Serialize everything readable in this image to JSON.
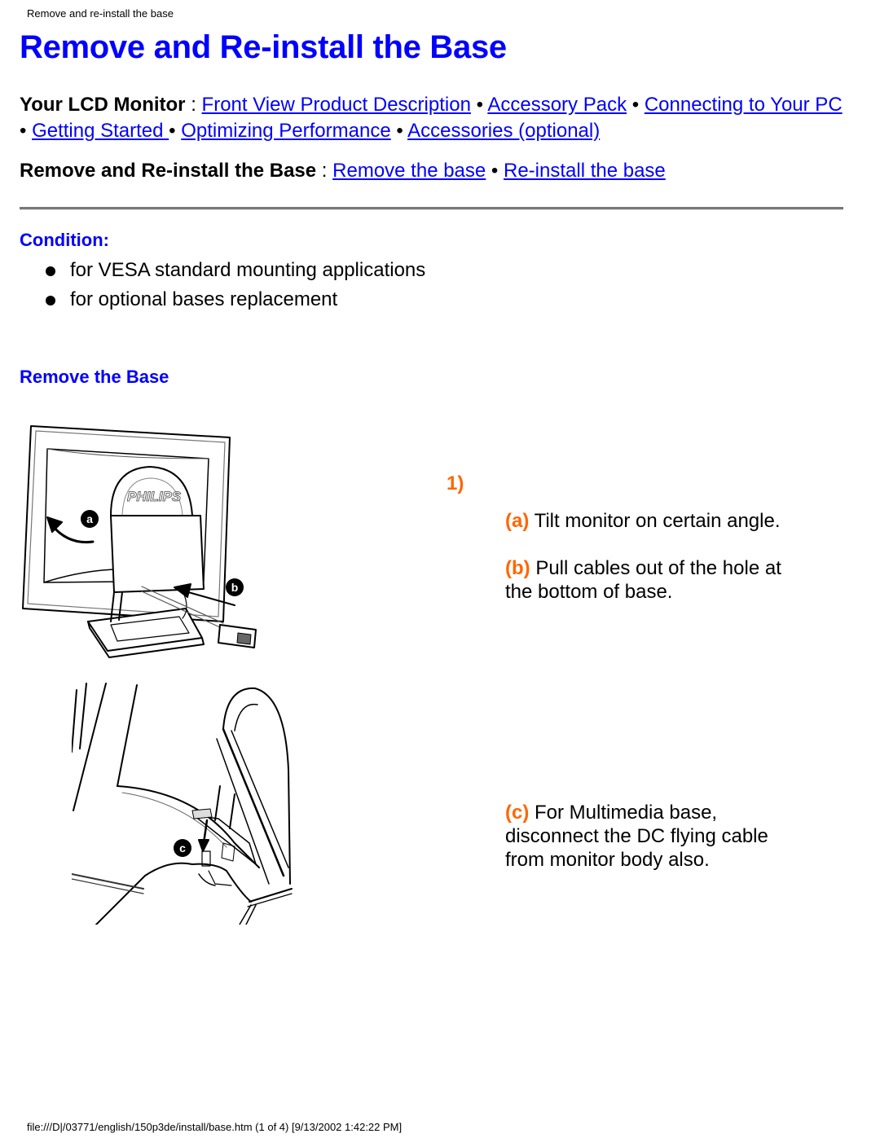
{
  "page_header": "Remove and re-install the base",
  "title": "Remove and Re-install the Base",
  "nav": {
    "label": "Your LCD Monitor",
    "separator": " : ",
    "bullet": " • ",
    "links": [
      "Front View Product Description",
      "Accessory Pack",
      "Connecting to Your PC ",
      "Getting Started ",
      "Optimizing Performance",
      "Accessories (optional)"
    ]
  },
  "sub_nav": {
    "label": "Remove and Re-install the Base",
    "separator": " : ",
    "bullet": " • ",
    "links": [
      "Remove the base",
      "Re-install the base"
    ]
  },
  "condition": {
    "heading": "Condition:",
    "items": [
      "for VESA standard mounting applications",
      "for optional bases replacement"
    ]
  },
  "remove_section": {
    "heading": "Remove the Base",
    "step_number": "1)",
    "steps": [
      {
        "tag": "(a)",
        "text": " Tilt monitor on certain angle."
      },
      {
        "tag": "(b)",
        "text": " Pull cables out of the hole at the bottom of base."
      },
      {
        "tag": "(c)",
        "text": " For Multimedia base, disconnect the DC flying cable from monitor body also."
      }
    ],
    "illustrations": [
      {
        "name": "monitor-back-illustration",
        "brand": "PHILIPS",
        "badges": [
          "a",
          "b"
        ]
      },
      {
        "name": "dc-cable-illustration",
        "badges": [
          "c"
        ]
      }
    ]
  },
  "colors": {
    "heading_blue": "#0000ff",
    "link_blue": "#0000ff",
    "step_orange": "#ff6600"
  },
  "footer": "file:///D|/03771/english/150p3de/install/base.htm (1 of 4) [9/13/2002 1:42:22 PM]"
}
